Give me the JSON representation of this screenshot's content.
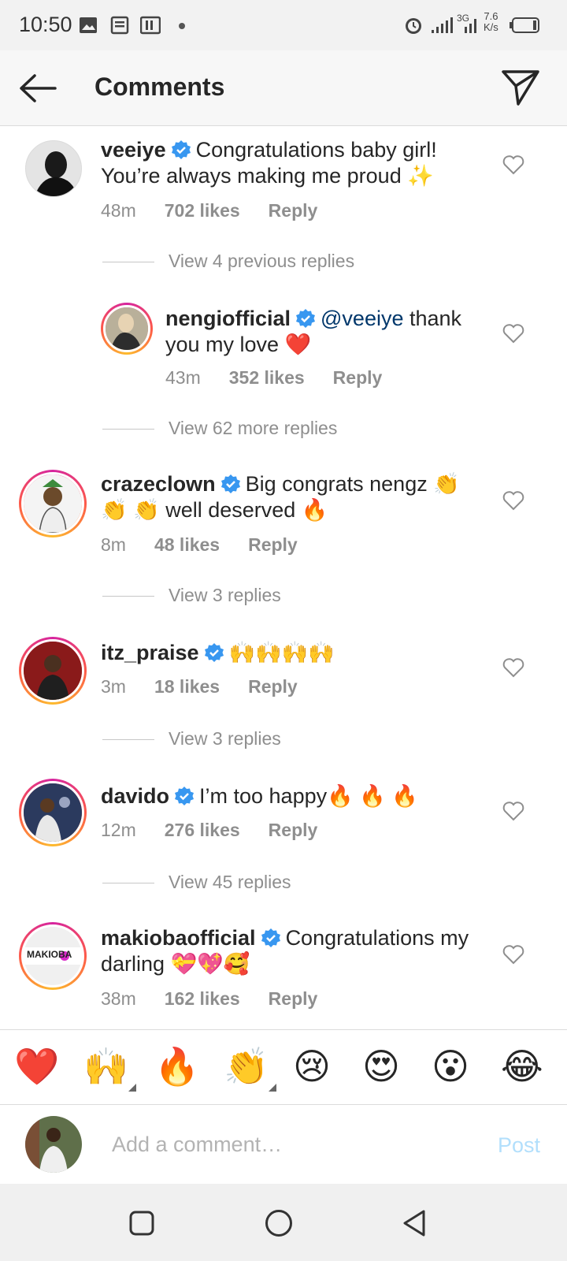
{
  "status_bar": {
    "time": "10:50",
    "network": "3G",
    "speed_value": "7.6",
    "speed_unit": "K/s"
  },
  "header": {
    "title": "Comments"
  },
  "comments": [
    {
      "username": "veeiye",
      "verified": true,
      "text": "Congratulations baby girl! You’re always making me proud ✨",
      "time": "48m",
      "likes": "702 likes",
      "reply": "Reply",
      "view_replies": "View 4 previous replies"
    },
    {
      "username": "nengiofficial",
      "verified": true,
      "mention": "@veeiye",
      "text": "thank you my love ❤️",
      "time": "43m",
      "likes": "352 likes",
      "reply": "Reply",
      "view_replies": "View 62 more replies"
    },
    {
      "username": "crazeclown",
      "verified": true,
      "text": "Big congrats nengz 👏 👏 👏 well deserved 🔥",
      "time": "8m",
      "likes": "48 likes",
      "reply": "Reply",
      "view_replies": "View 3 replies"
    },
    {
      "username": "itz_praise",
      "verified": true,
      "text": "🙌🙌🙌🙌",
      "time": "3m",
      "likes": "18 likes",
      "reply": "Reply",
      "view_replies": "View 3 replies"
    },
    {
      "username": "davido",
      "verified": true,
      "text": "I’m too happy🔥 🔥 🔥",
      "time": "12m",
      "likes": "276 likes",
      "reply": "Reply",
      "view_replies": "View 45 replies"
    },
    {
      "username": "makiobaofficial",
      "verified": true,
      "text": "Congratulations my darling 💝💖🥰",
      "time": "38m",
      "likes": "162 likes",
      "reply": "Reply",
      "avatar_logo_text": "MAKIOBA"
    }
  ],
  "emoji_bar": [
    "❤️",
    "🙌",
    "🔥",
    "👏",
    "😢",
    "😍",
    "😮",
    "😂"
  ],
  "input": {
    "placeholder": "Add a comment…",
    "post_label": "Post"
  },
  "colors": {
    "link": "#00376b",
    "verified": "#3897f0",
    "post_disabled": "#b2dffc",
    "muted": "#8e8e8e"
  }
}
